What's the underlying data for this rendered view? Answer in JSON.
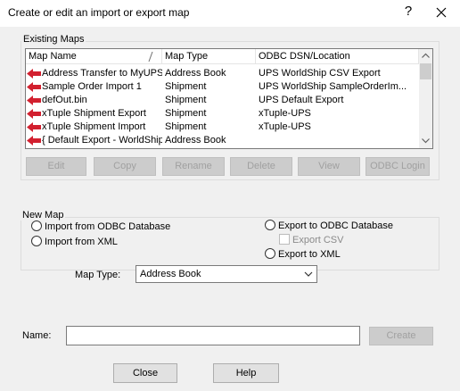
{
  "window": {
    "title": "Create or edit an import or export map",
    "help_glyph": "?",
    "close_glyph": "✕"
  },
  "existing_maps": {
    "group_label": "Existing Maps",
    "columns": [
      "Map Name",
      "Map Type",
      "ODBC DSN/Location"
    ],
    "rows": [
      {
        "name": "Address Transfer to MyUPS",
        "type": "Address Book",
        "location": "UPS WorldShip CSV Export"
      },
      {
        "name": "Sample Order Import 1",
        "type": "Shipment",
        "location": "UPS WorldShip SampleOrderIm..."
      },
      {
        "name": "defOut.bin",
        "type": "Shipment",
        "location": "UPS Default Export"
      },
      {
        "name": "xTuple Shipment Export",
        "type": "Shipment",
        "location": "xTuple-UPS"
      },
      {
        "name": "xTuple Shipment Import",
        "type": "Shipment",
        "location": "xTuple-UPS"
      },
      {
        "name": "{ Default Export - WorldShip }",
        "type": "Address Book",
        "location": ""
      }
    ],
    "buttons": {
      "edit": "Edit",
      "copy": "Copy",
      "rename": "Rename",
      "delete": "Delete",
      "view": "View",
      "odbc_login": "ODBC Login"
    },
    "arrow_color": "#d2202f"
  },
  "new_map": {
    "group_label": "New Map",
    "import_odbc": "Import from ODBC Database",
    "import_xml": "Import from XML",
    "export_odbc": "Export to ODBC Database",
    "export_csv": "Export CSV",
    "export_xml": "Export to XML",
    "map_type_label": "Map Type:",
    "map_type_value": "Address Book"
  },
  "name_row": {
    "label": "Name:",
    "value": "",
    "create_button": "Create"
  },
  "footer": {
    "close_button": "Close",
    "help_button": "Help"
  }
}
